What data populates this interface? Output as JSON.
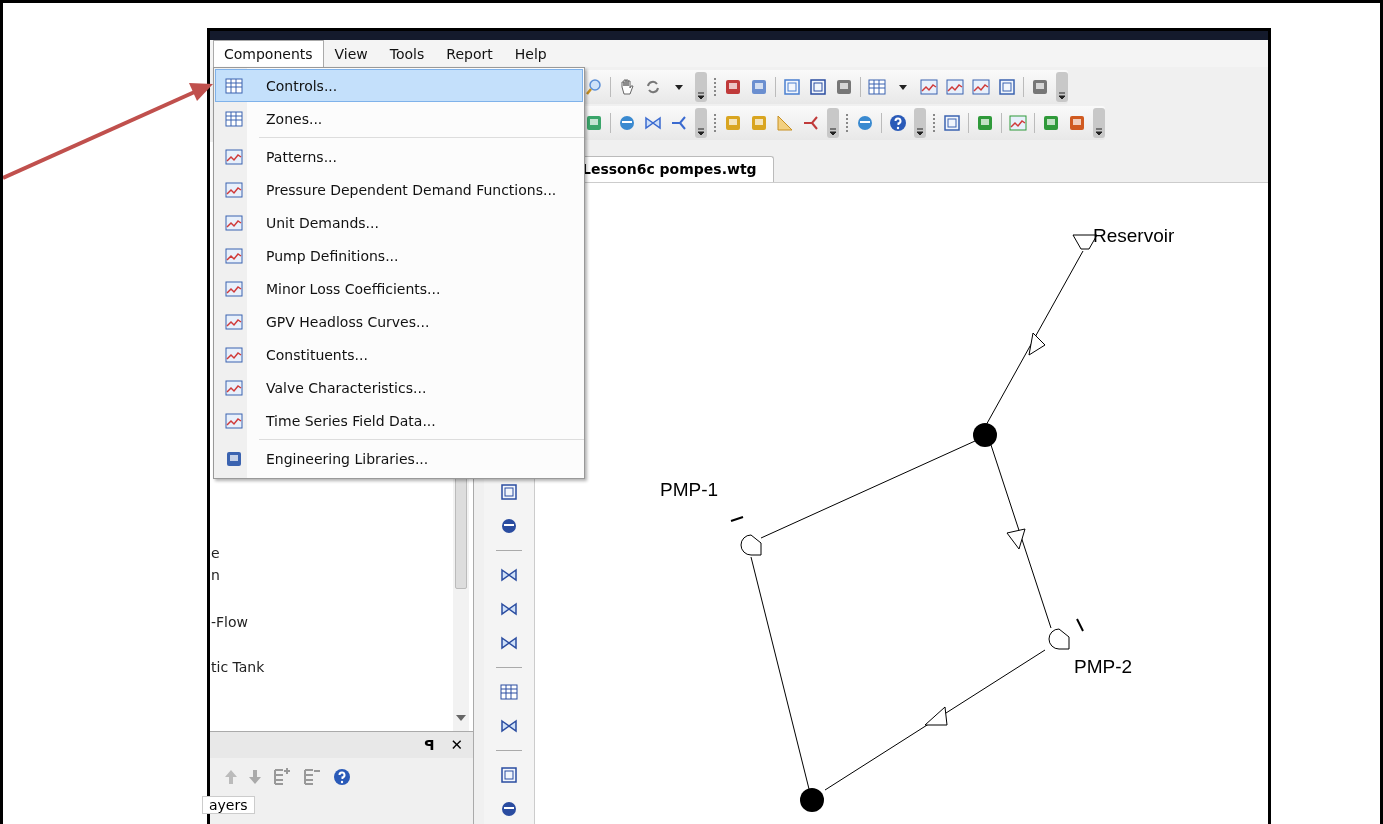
{
  "menu_bar": [
    {
      "label": "Components",
      "selected": true
    },
    {
      "label": "View",
      "selected": false
    },
    {
      "label": "Tools",
      "selected": false
    },
    {
      "label": "Report",
      "selected": false
    },
    {
      "label": "Help",
      "selected": false
    }
  ],
  "dropdown": [
    {
      "label": "Controls...",
      "selected": true,
      "separator_before": false
    },
    {
      "label": "Zones...",
      "selected": false,
      "separator_before": false
    },
    {
      "label": "Patterns...",
      "selected": false,
      "separator_before": true
    },
    {
      "label": "Pressure Dependent Demand Functions...",
      "selected": false,
      "separator_before": false
    },
    {
      "label": "Unit Demands...",
      "selected": false,
      "separator_before": false
    },
    {
      "label": "Pump Definitions...",
      "selected": false,
      "separator_before": false
    },
    {
      "label": "Minor Loss Coefficients...",
      "selected": false,
      "separator_before": false
    },
    {
      "label": "GPV Headloss Curves...",
      "selected": false,
      "separator_before": false
    },
    {
      "label": "Constituents...",
      "selected": false,
      "separator_before": false
    },
    {
      "label": "Valve Characteristics...",
      "selected": false,
      "separator_before": false
    },
    {
      "label": "Time Series Field Data...",
      "selected": false,
      "separator_before": false
    },
    {
      "label": "Engineering Libraries...",
      "selected": false,
      "separator_before": true
    }
  ],
  "left_panel": {
    "items": [
      "e",
      "n",
      "-Flow",
      "tic Tank"
    ]
  },
  "bottom_panel": {
    "pin": "ꟼ",
    "close": "✕",
    "tab": "ayers"
  },
  "document_tab": {
    "label": "Lesson6c pompes.wtg"
  },
  "diagram": {
    "labels": [
      {
        "text": "Reservoir",
        "kind": "reservoir"
      },
      {
        "text": "PMP-1",
        "kind": "pump1"
      },
      {
        "text": "PMP-2",
        "kind": "pump2"
      }
    ]
  }
}
